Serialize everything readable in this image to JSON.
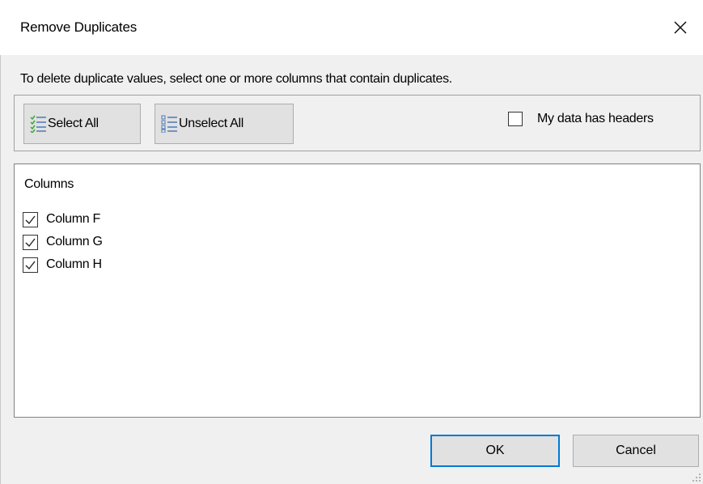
{
  "dialog": {
    "title": "Remove Duplicates",
    "close_icon": "close-icon"
  },
  "instruction": "To delete duplicate values, select one or more columns that contain duplicates.",
  "toolbar": {
    "select_all_label": "Select All",
    "select_all_icon": "checklist-checked-icon",
    "unselect_all_label": "Unselect All",
    "unselect_all_icon": "checklist-unchecked-icon",
    "headers_label": "My data has headers",
    "headers_checked": false
  },
  "columns": {
    "header": "Columns",
    "items": [
      {
        "label": "Column F",
        "checked": true
      },
      {
        "label": "Column G",
        "checked": true
      },
      {
        "label": "Column H",
        "checked": true
      }
    ]
  },
  "buttons": {
    "ok_label": "OK",
    "cancel_label": "Cancel"
  },
  "colors": {
    "focus_border": "#0078d7",
    "check_green": "#3aa63a",
    "list_blue": "#4a7ab8"
  }
}
